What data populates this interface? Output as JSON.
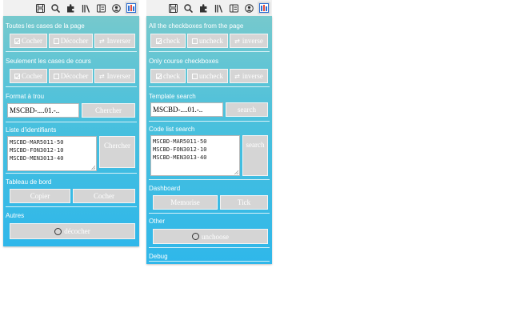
{
  "toolbar": {
    "icons": [
      "save-icon",
      "search-icon",
      "puzzle-icon",
      "library-icon",
      "reader-icon",
      "account-icon",
      "extension-icon"
    ]
  },
  "colors": {
    "gradient_top": "#76c9cd",
    "gradient_bottom": "#2fb7ea",
    "button": "#d5d5d5"
  },
  "fr": {
    "all_title": "Toutes les cases de la page",
    "check": "Cocher",
    "uncheck": "Décocher",
    "invert": "Inverser",
    "course_title": "Seulement les cases de cours",
    "template_title": "Format à trou",
    "template_value": "MSCBD-....01.-..",
    "search": "Chercher",
    "list_title": "Liste d'identifiants",
    "list_lines": [
      "MSCBD-MAR5011-50",
      "MSCBD-FON3012-10",
      "MSCBD-MEN3013-40"
    ],
    "dashboard_title": "Tableau de bord",
    "copy": "Copier",
    "tick": "Cocher",
    "other_title": "Autres",
    "unchoose": "décocher"
  },
  "en": {
    "all_title": "All the checkboxes from the page",
    "check": "check",
    "uncheck": "uncheck",
    "invert": "inverse",
    "course_title": "Only course checkboxes",
    "template_title": "Template search",
    "template_value": "MSCBD-....01.-..",
    "search": "search",
    "list_title": "Code list search",
    "list_lines": [
      "MSCBD-MAR5011-50",
      "MSCBD-FON3012-10",
      "MSCBD-MEN3013-40"
    ],
    "dashboard_title": "Dashboard",
    "memorise": "Memorise",
    "tick": "Tick",
    "other_title": "Other",
    "unchoose": "unchoose",
    "debug_title": "Debug"
  }
}
